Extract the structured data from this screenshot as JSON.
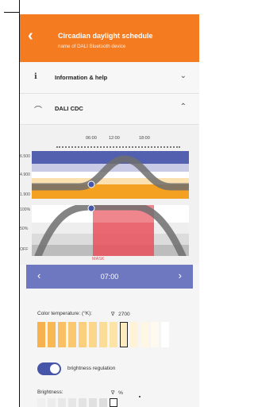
{
  "header": {
    "back_icon": "chevron-left-icon",
    "title": "Circadian daylight schedule",
    "subtitle": "name of DALI Bluetooth device",
    "color": "#f47b20"
  },
  "sections": [
    {
      "icon": "info-icon",
      "label": "Information & help",
      "chevron": "chevron-down-icon"
    },
    {
      "icon": "arc-icon",
      "label": "DALI CDC",
      "chevron": "chevron-up-icon"
    }
  ],
  "timeline": {
    "labels": [
      "06:00",
      "12:00",
      "18:00"
    ]
  },
  "color_chart": {
    "y_labels": [
      "6.500",
      "4.900",
      "1.900"
    ],
    "accent_top": "#5360b0",
    "accent_bottom": "#f4a020"
  },
  "brightness_chart": {
    "y_labels": [
      "100%",
      "50%",
      "OFF"
    ],
    "mask_label": "MASK",
    "mask_color": "#e8505b"
  },
  "editor": {
    "time": "07:00",
    "prev_icon": "chevron-left-icon",
    "next_icon": "chevron-right-icon",
    "color_temp_label": "Color temperature: (°K):",
    "color_temp_value": "2700",
    "value_marker": "∇",
    "selected_swatch": 8,
    "swatch_colors": [
      "#f7b24f",
      "#f8b955",
      "#f9c065",
      "#f9c870",
      "#fad07e",
      "#fbd78b",
      "#fbdd98",
      "#fce3a6",
      "#fdebc0",
      "#fef3d7",
      "#fef7e4",
      "#fefaf0",
      "#ffffff"
    ],
    "brightness_regulation_label": "brightness regulation",
    "brightness_regulation_on": true,
    "brightness_label": "Brightness:",
    "brightness_value": "%",
    "brightness_swatches": [
      "#f0f0f0",
      "#ececec",
      "#e8e8e8",
      "#e6e6e6",
      "#e3e3e3",
      "#e0e0e0",
      "#dddddd",
      "#ffffff"
    ]
  }
}
